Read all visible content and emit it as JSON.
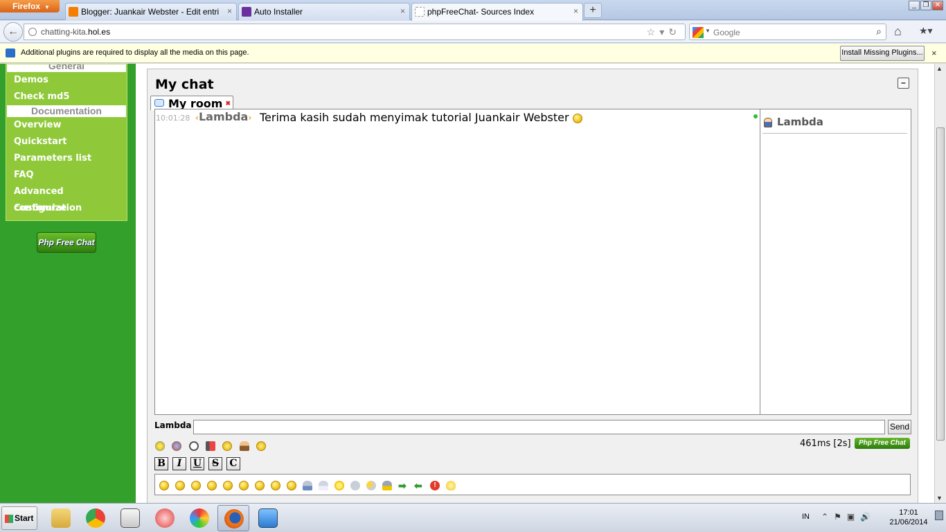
{
  "browser": {
    "menu_label": "Firefox",
    "tabs": [
      {
        "label": "Blogger: Juankair Webster - Edit entri",
        "favicon_color": "#f57d00"
      },
      {
        "label": "Auto Installer",
        "favicon_color": "#6b2fa0"
      },
      {
        "label": "phpFreeChat- Sources Index",
        "favicon_color": "#ffffff"
      }
    ],
    "new_tab_symbol": "+",
    "url_prefix": "chatting-kita.",
    "url_domain": "hol.es",
    "search_placeholder": "Google",
    "notification": "Additional plugins are required to display all the media on this page.",
    "install_button": "Install Missing Plugins...",
    "close_symbol": "×"
  },
  "sidebar": {
    "section_general": "General",
    "items_top": [
      "Demos",
      "Check md5"
    ],
    "section_docs": "Documentation",
    "items_docs": [
      "Overview",
      "Quickstart",
      "Parameters list",
      "FAQ",
      "Advanced configuration",
      "Customize"
    ],
    "logo_text": "Php Free Chat"
  },
  "chat": {
    "title": "My chat",
    "minimize_symbol": "–",
    "room_tab": "My room",
    "messages": [
      {
        "time": "10:01:28",
        "nick": "Lambda",
        "text": "Terima kasih sudah menyimak tutorial Juankair Webster"
      }
    ],
    "users": [
      "Lambda"
    ],
    "nick_label": "Lambda",
    "input_value": "",
    "send_label": "Send",
    "perf": "461ms [2s]",
    "mini_logo": "Php Free Chat",
    "format_buttons": [
      "B",
      "I",
      "U",
      "S",
      "C"
    ],
    "command_icons": [
      "smiley-icon",
      "colors-icon",
      "clock-icon",
      "sound-icon",
      "emoticon-icon",
      "user-icon",
      "emoticon-toggle-icon"
    ],
    "smileys": [
      "smile",
      "laugh",
      "surprised",
      "grin",
      "sad",
      "cool",
      "wink",
      "happy",
      "tongue",
      "rain",
      "snow",
      "sun",
      "cloud",
      "partly-sunny",
      "storm",
      "arrow-right",
      "arrow-left",
      "warning",
      "idea"
    ]
  },
  "taskbar": {
    "start_label": "Start",
    "apps": [
      "file-explorer",
      "chrome",
      "media-player",
      "paint",
      "firefox",
      "video-player"
    ],
    "lang": "IN",
    "time": "17:01",
    "date": "21/06/2014"
  },
  "colors": {
    "page_green": "#33a02c",
    "sidebar_green": "#8fc93a",
    "nick_bracket": "#f29f1c"
  }
}
